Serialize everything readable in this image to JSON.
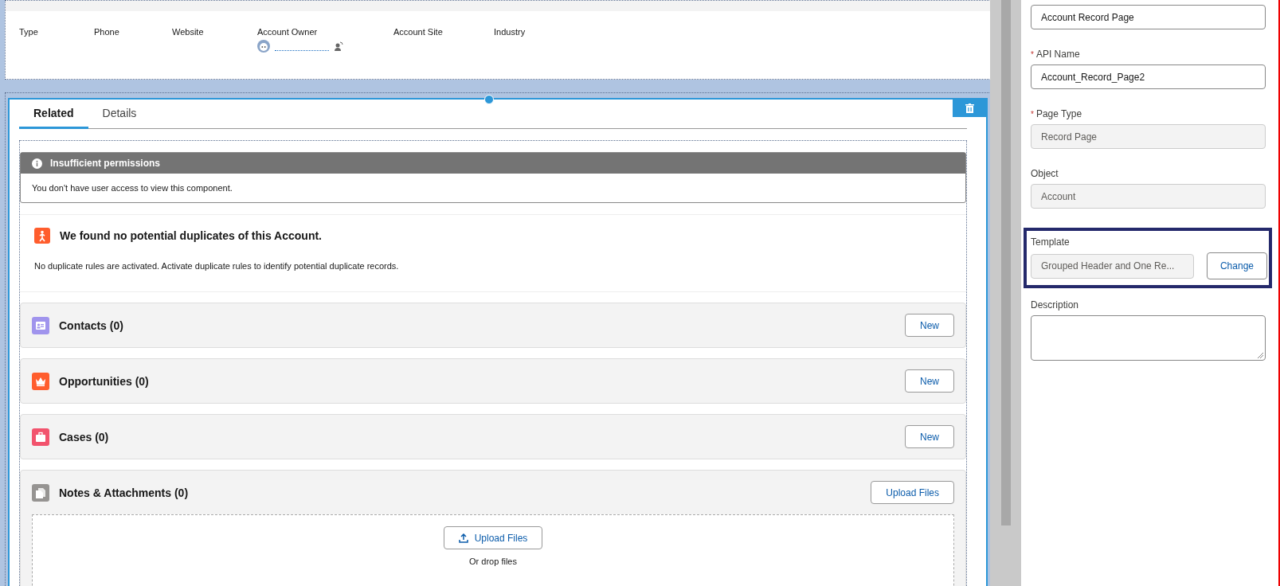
{
  "header_fields": [
    {
      "kind": "plain",
      "label": "Type"
    },
    {
      "kind": "plain",
      "label": "Phone"
    },
    {
      "kind": "plain",
      "label": "Website"
    },
    {
      "kind": "owner",
      "label": "Account Owner"
    },
    {
      "kind": "plain",
      "label": "Account Site"
    },
    {
      "kind": "plain",
      "label": "Industry"
    }
  ],
  "tabs": [
    {
      "label": "Related",
      "selected": true
    },
    {
      "label": "Details",
      "selected": false
    }
  ],
  "permission_alert": {
    "title": "Insufficient permissions",
    "message": "You don't have user access to view this component."
  },
  "duplicates": {
    "title": "We found no potential duplicates of this Account.",
    "message": "No duplicate rules are activated. Activate duplicate rules to identify potential duplicate records."
  },
  "related_lists": [
    {
      "kind": "contact",
      "color": "#a094ed",
      "title": "Contacts (0)",
      "button": "New"
    },
    {
      "kind": "opportunity",
      "color": "#ff5d2d",
      "title": "Opportunities (0)",
      "button": "New"
    },
    {
      "kind": "case",
      "color": "#f2536d",
      "title": "Cases (0)",
      "button": "New"
    },
    {
      "kind": "file",
      "color": "#969492",
      "title": "Notes & Attachments (0)",
      "button": "Upload Files",
      "dropzone": {
        "button": "Upload Files",
        "hint": "Or drop files"
      }
    }
  ],
  "properties": [
    {
      "kind": "text",
      "value": "Account Record Page"
    },
    {
      "kind": "text",
      "marker": "*",
      "label": "API Name",
      "value": "Account_Record_Page2"
    },
    {
      "kind": "readonly",
      "marker": "*",
      "label": "Page Type",
      "value": "Record Page"
    },
    {
      "kind": "readonly",
      "label": "Object",
      "value": "Account"
    },
    {
      "kind": "template",
      "label": "Template",
      "value": "Grouped Header and One Re...",
      "button": "Change",
      "highlighted": true
    },
    {
      "kind": "textarea",
      "label": "Description"
    }
  ]
}
